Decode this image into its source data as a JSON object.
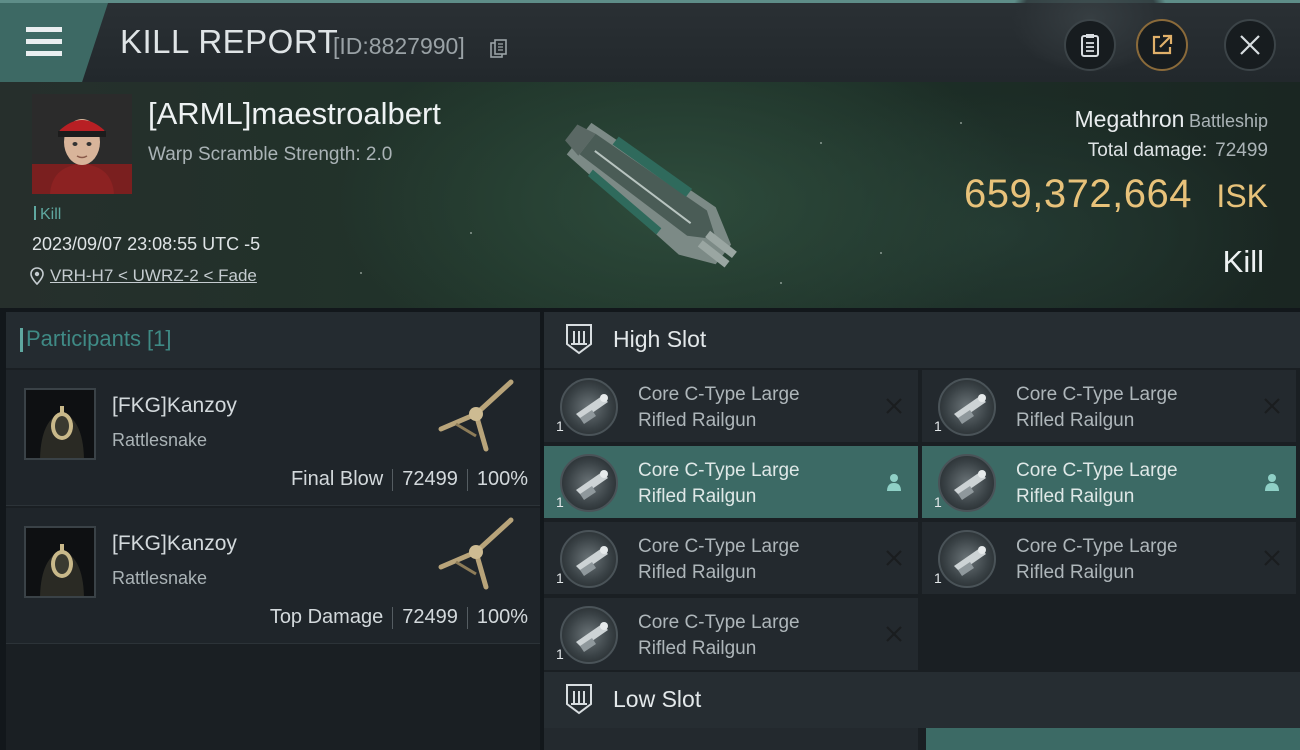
{
  "header": {
    "title": "KILL REPORT",
    "report_id": "[ID:8827990]"
  },
  "victim": {
    "name": "[ARML]maestroalbert",
    "warp_scramble": "Warp Scramble Strength: 2.0",
    "tag": "Kill",
    "timestamp": "2023/09/07 23:08:55 UTC -5",
    "location": "VRH-H7 < UWRZ-2 < Fade"
  },
  "ship": {
    "name": "Megathron",
    "class": "Battleship",
    "total_damage_label": "Total damage:",
    "total_damage_value": "72499",
    "isk_value": "659,372,664",
    "isk_unit": "ISK",
    "result": "Kill"
  },
  "participants": {
    "header": "Participants [1]",
    "rows": [
      {
        "name": "[FKG]Kanzoy",
        "ship": "Rattlesnake",
        "role": "Final Blow",
        "damage": "72499",
        "percent": "100%"
      },
      {
        "name": "[FKG]Kanzoy",
        "ship": "Rattlesnake",
        "role": "Top Damage",
        "damage": "72499",
        "percent": "100%"
      }
    ]
  },
  "slots": {
    "high_label": "High Slot",
    "low_label": "Low Slot",
    "modules": [
      {
        "line1": "Core C-Type Large",
        "line2": "Rifled Railgun",
        "qty": "1",
        "status": "destroyed"
      },
      {
        "line1": "Core C-Type Large",
        "line2": "Rifled Railgun",
        "qty": "1",
        "status": "destroyed"
      },
      {
        "line1": "Core C-Type Large",
        "line2": "Rifled Railgun",
        "qty": "1",
        "status": "dropped"
      },
      {
        "line1": "Core C-Type Large",
        "line2": "Rifled Railgun",
        "qty": "1",
        "status": "dropped"
      },
      {
        "line1": "Core C-Type Large",
        "line2": "Rifled Railgun",
        "qty": "1",
        "status": "destroyed"
      },
      {
        "line1": "Core C-Type Large",
        "line2": "Rifled Railgun",
        "qty": "1",
        "status": "destroyed"
      },
      {
        "line1": "Core C-Type Large",
        "line2": "Rifled Railgun",
        "qty": "1",
        "status": "destroyed"
      }
    ]
  },
  "colors": {
    "accent": "#3c6a65",
    "isk": "#e8c27a",
    "teal_text": "#5fa8a0"
  }
}
